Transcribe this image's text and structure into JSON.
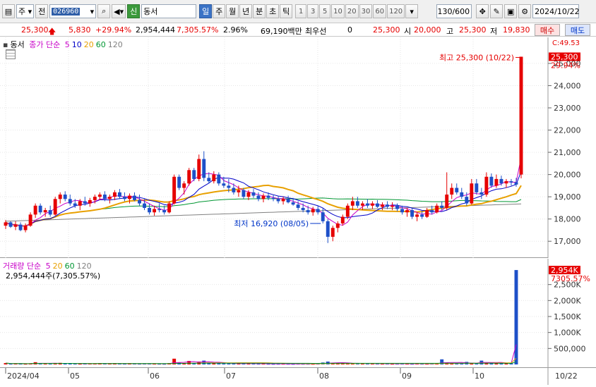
{
  "toolbar": {
    "market": "주",
    "scope": "전",
    "code": "026960",
    "badge": "신",
    "name": "동서",
    "periods": [
      "일",
      "주",
      "월",
      "년",
      "분",
      "초",
      "틱"
    ],
    "active_period": "일",
    "minutes": [
      "1",
      "3",
      "5",
      "10",
      "20",
      "30",
      "60",
      "120"
    ],
    "count": "130",
    "count_total": "/600",
    "date": "2024/10/22"
  },
  "quote": {
    "price": "25,300",
    "change": "5,830",
    "change_pct": "+29.94%",
    "volume": "2,954,444",
    "volume_ratio": "7,305.57%",
    "turnover": "2.96%",
    "amount": "69,190백만",
    "pref_label": "최우선",
    "pref_val": "0",
    "pref_price": "25,300",
    "open_label": "시",
    "open": "20,000",
    "high_label": "고",
    "high": "25,300",
    "low_label": "저",
    "low": "19,830",
    "buy_label": "매수",
    "sell_label": "매도"
  },
  "price_legend": {
    "name": "동서",
    "label": "종가 단순",
    "ma": [
      "5",
      "10",
      "20",
      "60",
      "120"
    ]
  },
  "vol_legend": {
    "label": "거래량 단순",
    "ma": [
      "5",
      "20",
      "60",
      "120"
    ],
    "value": "2,954,444주(7,305.57%)"
  },
  "annotations": {
    "high": "최고 25,300 (10/22)",
    "low": "최저 16,920 (08/05)"
  },
  "price_axis": {
    "ticks": [
      "25,000",
      "24,000",
      "23,000",
      "22,000",
      "21,000",
      "20,000",
      "19,000",
      "18,000",
      "17,000"
    ],
    "current": "25,300",
    "pct": "29.94%",
    "top": "C:49.53"
  },
  "vol_axis": {
    "ticks": [
      "2,500K",
      "2,000K",
      "1,500K",
      "1,000K",
      "500,000"
    ],
    "current": "2,954K",
    "pct": "7305.57%"
  },
  "time_axis": {
    "labels": [
      "2024/04",
      "05",
      "06",
      "07",
      "08",
      "09",
      "10"
    ],
    "right": "10/22"
  },
  "colors": {
    "up": "#e60000",
    "down": "#1e50c8",
    "ma5": "#c800c8",
    "ma10": "#0000c8",
    "ma20": "#e8a000",
    "ma60": "#009632",
    "ma120": "#808080"
  },
  "chart_data": {
    "type": "candlestick",
    "ylim": [
      16500,
      25600
    ],
    "candles": [
      {
        "o": 17700,
        "h": 17950,
        "l": 17550,
        "c": 17850
      },
      {
        "o": 17850,
        "h": 17900,
        "l": 17600,
        "c": 17650
      },
      {
        "o": 17650,
        "h": 17900,
        "l": 17500,
        "c": 17750
      },
      {
        "o": 17750,
        "h": 17850,
        "l": 17450,
        "c": 17500
      },
      {
        "o": 17500,
        "h": 17800,
        "l": 17400,
        "c": 17700
      },
      {
        "o": 17700,
        "h": 18300,
        "l": 17650,
        "c": 18200
      },
      {
        "o": 18200,
        "h": 18700,
        "l": 18050,
        "c": 18600
      },
      {
        "o": 18600,
        "h": 18700,
        "l": 18200,
        "c": 18300
      },
      {
        "o": 18300,
        "h": 18500,
        "l": 18100,
        "c": 18400
      },
      {
        "o": 18400,
        "h": 18600,
        "l": 18100,
        "c": 18200
      },
      {
        "o": 18200,
        "h": 19000,
        "l": 18150,
        "c": 18900
      },
      {
        "o": 18900,
        "h": 19200,
        "l": 18700,
        "c": 19100
      },
      {
        "o": 19100,
        "h": 19250,
        "l": 18800,
        "c": 18900
      },
      {
        "o": 18900,
        "h": 19100,
        "l": 18600,
        "c": 18700
      },
      {
        "o": 18700,
        "h": 18900,
        "l": 18500,
        "c": 18600
      },
      {
        "o": 18600,
        "h": 18900,
        "l": 18400,
        "c": 18800
      },
      {
        "o": 18800,
        "h": 19000,
        "l": 18600,
        "c": 18700
      },
      {
        "o": 18700,
        "h": 18950,
        "l": 18550,
        "c": 18850
      },
      {
        "o": 18850,
        "h": 19100,
        "l": 18700,
        "c": 19000
      },
      {
        "o": 19000,
        "h": 19200,
        "l": 18850,
        "c": 19100
      },
      {
        "o": 19100,
        "h": 19250,
        "l": 18800,
        "c": 18900
      },
      {
        "o": 18900,
        "h": 19100,
        "l": 18700,
        "c": 19000
      },
      {
        "o": 19000,
        "h": 19300,
        "l": 18850,
        "c": 19200
      },
      {
        "o": 19200,
        "h": 19350,
        "l": 18900,
        "c": 19000
      },
      {
        "o": 19000,
        "h": 19200,
        "l": 18800,
        "c": 18900
      },
      {
        "o": 18900,
        "h": 19150,
        "l": 18700,
        "c": 19050
      },
      {
        "o": 19050,
        "h": 19200,
        "l": 18800,
        "c": 18850
      },
      {
        "o": 18850,
        "h": 19100,
        "l": 18600,
        "c": 18700
      },
      {
        "o": 18700,
        "h": 18900,
        "l": 18400,
        "c": 18500
      },
      {
        "o": 18500,
        "h": 18700,
        "l": 18200,
        "c": 18300
      },
      {
        "o": 18300,
        "h": 18600,
        "l": 18150,
        "c": 18450
      },
      {
        "o": 18450,
        "h": 18700,
        "l": 18300,
        "c": 18400
      },
      {
        "o": 18400,
        "h": 18600,
        "l": 18200,
        "c": 18300
      },
      {
        "o": 18300,
        "h": 18800,
        "l": 18250,
        "c": 18700
      },
      {
        "o": 18700,
        "h": 20000,
        "l": 18650,
        "c": 19900
      },
      {
        "o": 19900,
        "h": 20000,
        "l": 19300,
        "c": 19400
      },
      {
        "o": 19400,
        "h": 19700,
        "l": 19100,
        "c": 19600
      },
      {
        "o": 19600,
        "h": 20300,
        "l": 19500,
        "c": 20200
      },
      {
        "o": 20200,
        "h": 20300,
        "l": 19700,
        "c": 19800
      },
      {
        "o": 19800,
        "h": 20900,
        "l": 19700,
        "c": 20700
      },
      {
        "o": 20700,
        "h": 21050,
        "l": 19700,
        "c": 19850
      },
      {
        "o": 19850,
        "h": 20100,
        "l": 19600,
        "c": 19700
      },
      {
        "o": 19700,
        "h": 20150,
        "l": 19600,
        "c": 20000
      },
      {
        "o": 20000,
        "h": 20100,
        "l": 19500,
        "c": 19600
      },
      {
        "o": 19600,
        "h": 19900,
        "l": 19400,
        "c": 19500
      },
      {
        "o": 19500,
        "h": 19800,
        "l": 19200,
        "c": 19400
      },
      {
        "o": 19400,
        "h": 19600,
        "l": 19100,
        "c": 19200
      },
      {
        "o": 19200,
        "h": 19500,
        "l": 19000,
        "c": 19300
      },
      {
        "o": 19300,
        "h": 19400,
        "l": 18900,
        "c": 19000
      },
      {
        "o": 19000,
        "h": 19300,
        "l": 18850,
        "c": 19200
      },
      {
        "o": 19200,
        "h": 19350,
        "l": 18950,
        "c": 19050
      },
      {
        "o": 19050,
        "h": 19200,
        "l": 18800,
        "c": 18900
      },
      {
        "o": 18900,
        "h": 19150,
        "l": 18750,
        "c": 19050
      },
      {
        "o": 19050,
        "h": 19200,
        "l": 18850,
        "c": 18950
      },
      {
        "o": 18950,
        "h": 19100,
        "l": 18800,
        "c": 18900
      },
      {
        "o": 18900,
        "h": 19050,
        "l": 18700,
        "c": 18800
      },
      {
        "o": 18800,
        "h": 19000,
        "l": 18650,
        "c": 18900
      },
      {
        "o": 18900,
        "h": 19050,
        "l": 18700,
        "c": 18750
      },
      {
        "o": 18750,
        "h": 18950,
        "l": 18600,
        "c": 18650
      },
      {
        "o": 18650,
        "h": 18800,
        "l": 18400,
        "c": 18500
      },
      {
        "o": 18500,
        "h": 18700,
        "l": 18300,
        "c": 18400
      },
      {
        "o": 18400,
        "h": 18600,
        "l": 18200,
        "c": 18300
      },
      {
        "o": 18300,
        "h": 18550,
        "l": 18150,
        "c": 18450
      },
      {
        "o": 18450,
        "h": 18600,
        "l": 18200,
        "c": 18300
      },
      {
        "o": 18300,
        "h": 18500,
        "l": 17800,
        "c": 17900
      },
      {
        "o": 17900,
        "h": 18000,
        "l": 16920,
        "c": 17200
      },
      {
        "o": 17200,
        "h": 17700,
        "l": 17000,
        "c": 17600
      },
      {
        "o": 17600,
        "h": 17900,
        "l": 17400,
        "c": 17800
      },
      {
        "o": 17800,
        "h": 18200,
        "l": 17700,
        "c": 18100
      },
      {
        "o": 18100,
        "h": 18700,
        "l": 18000,
        "c": 18600
      },
      {
        "o": 18600,
        "h": 19000,
        "l": 18400,
        "c": 18800
      },
      {
        "o": 18800,
        "h": 19000,
        "l": 18500,
        "c": 18600
      },
      {
        "o": 18600,
        "h": 18800,
        "l": 18400,
        "c": 18700
      },
      {
        "o": 18700,
        "h": 18900,
        "l": 18500,
        "c": 18600
      },
      {
        "o": 18600,
        "h": 18800,
        "l": 18450,
        "c": 18700
      },
      {
        "o": 18700,
        "h": 18850,
        "l": 18500,
        "c": 18550
      },
      {
        "o": 18550,
        "h": 18750,
        "l": 18400,
        "c": 18650
      },
      {
        "o": 18650,
        "h": 18800,
        "l": 18450,
        "c": 18550
      },
      {
        "o": 18550,
        "h": 18750,
        "l": 18400,
        "c": 18600
      },
      {
        "o": 18600,
        "h": 18700,
        "l": 18350,
        "c": 18450
      },
      {
        "o": 18450,
        "h": 18600,
        "l": 18200,
        "c": 18300
      },
      {
        "o": 18300,
        "h": 18500,
        "l": 18100,
        "c": 18400
      },
      {
        "o": 18400,
        "h": 18500,
        "l": 18000,
        "c": 18100
      },
      {
        "o": 18100,
        "h": 18300,
        "l": 17900,
        "c": 18200
      },
      {
        "o": 18200,
        "h": 18400,
        "l": 18000,
        "c": 18100
      },
      {
        "o": 18100,
        "h": 18500,
        "l": 18050,
        "c": 18400
      },
      {
        "o": 18400,
        "h": 18600,
        "l": 18200,
        "c": 18300
      },
      {
        "o": 18300,
        "h": 18700,
        "l": 18250,
        "c": 18600
      },
      {
        "o": 18600,
        "h": 18800,
        "l": 18400,
        "c": 18500
      },
      {
        "o": 18500,
        "h": 20100,
        "l": 18400,
        "c": 19100
      },
      {
        "o": 19100,
        "h": 19600,
        "l": 18900,
        "c": 19400
      },
      {
        "o": 19400,
        "h": 19600,
        "l": 19100,
        "c": 19200
      },
      {
        "o": 19200,
        "h": 19400,
        "l": 18900,
        "c": 19000
      },
      {
        "o": 19000,
        "h": 19200,
        "l": 18600,
        "c": 18700
      },
      {
        "o": 18700,
        "h": 19800,
        "l": 18650,
        "c": 19600
      },
      {
        "o": 19600,
        "h": 19800,
        "l": 19100,
        "c": 19200
      },
      {
        "o": 19200,
        "h": 19400,
        "l": 18900,
        "c": 19100
      },
      {
        "o": 19100,
        "h": 20100,
        "l": 19000,
        "c": 19900
      },
      {
        "o": 19900,
        "h": 20050,
        "l": 19400,
        "c": 19500
      },
      {
        "o": 19500,
        "h": 20000,
        "l": 19400,
        "c": 19800
      },
      {
        "o": 19800,
        "h": 19950,
        "l": 19500,
        "c": 19600
      },
      {
        "o": 19600,
        "h": 19800,
        "l": 19400,
        "c": 19700
      },
      {
        "o": 19700,
        "h": 19800,
        "l": 19500,
        "c": 19650
      },
      {
        "o": 19650,
        "h": 19850,
        "l": 19450,
        "c": 19550
      },
      {
        "o": 20000,
        "h": 25300,
        "l": 19830,
        "c": 25300
      }
    ],
    "volume": [
      42,
      18,
      22,
      20,
      18,
      35,
      70,
      30,
      25,
      20,
      45,
      50,
      30,
      25,
      20,
      18,
      22,
      25,
      30,
      40,
      28,
      22,
      30,
      25,
      20,
      22,
      24,
      20,
      22,
      26,
      20,
      18,
      16,
      40,
      180,
      60,
      40,
      110,
      50,
      90,
      120,
      60,
      40,
      35,
      30,
      30,
      28,
      25,
      30,
      25,
      22,
      20,
      22,
      18,
      16,
      18,
      20,
      18,
      16,
      20,
      18,
      18,
      16,
      20,
      60,
      90,
      50,
      40,
      35,
      40,
      30,
      28,
      26,
      25,
      24,
      22,
      20,
      22,
      18,
      20,
      25,
      20,
      18,
      22,
      20,
      18,
      25,
      20,
      160,
      60,
      40,
      30,
      35,
      80,
      40,
      30,
      120,
      50,
      60,
      45,
      40,
      40,
      35,
      2954
    ]
  }
}
